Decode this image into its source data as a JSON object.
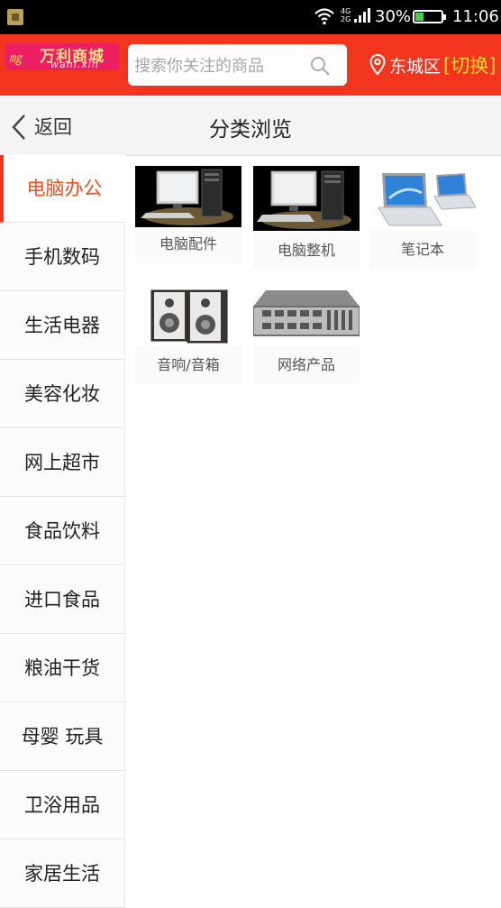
{
  "status_bar": {
    "network": "4G\n2G",
    "battery_percent": "30%",
    "battery_level": 0.3,
    "time": "11:06"
  },
  "header": {
    "logo_title": "万利商城",
    "logo_sub": "wanl.xin",
    "search_placeholder": "搜索你关注的商品",
    "location": "东城区",
    "switch_label": "[切换]"
  },
  "nav": {
    "back_label": "返回",
    "title": "分类浏览"
  },
  "sidebar": {
    "items": [
      {
        "label": "电脑办公",
        "active": true
      },
      {
        "label": "手机数码"
      },
      {
        "label": "生活电器"
      },
      {
        "label": "美容化妆"
      },
      {
        "label": "网上超市"
      },
      {
        "label": "食品饮料"
      },
      {
        "label": "进口食品"
      },
      {
        "label": "粮油干货"
      },
      {
        "label": "母婴 玩具"
      },
      {
        "label": "卫浴用品"
      },
      {
        "label": "家居生活"
      }
    ]
  },
  "products": [
    {
      "label": "电脑配件",
      "icon": "desktop-computer-icon"
    },
    {
      "label": "电脑整机",
      "icon": "desktop-computer-icon"
    },
    {
      "label": "笔记本",
      "icon": "laptop-icon"
    },
    {
      "label": "音响/音箱",
      "icon": "speaker-icon"
    },
    {
      "label": "网络产品",
      "icon": "network-switch-icon"
    }
  ],
  "colors": {
    "brand_red": "#f2351e",
    "active_text": "#e8501e",
    "switch_yellow": "#ffd53a"
  }
}
